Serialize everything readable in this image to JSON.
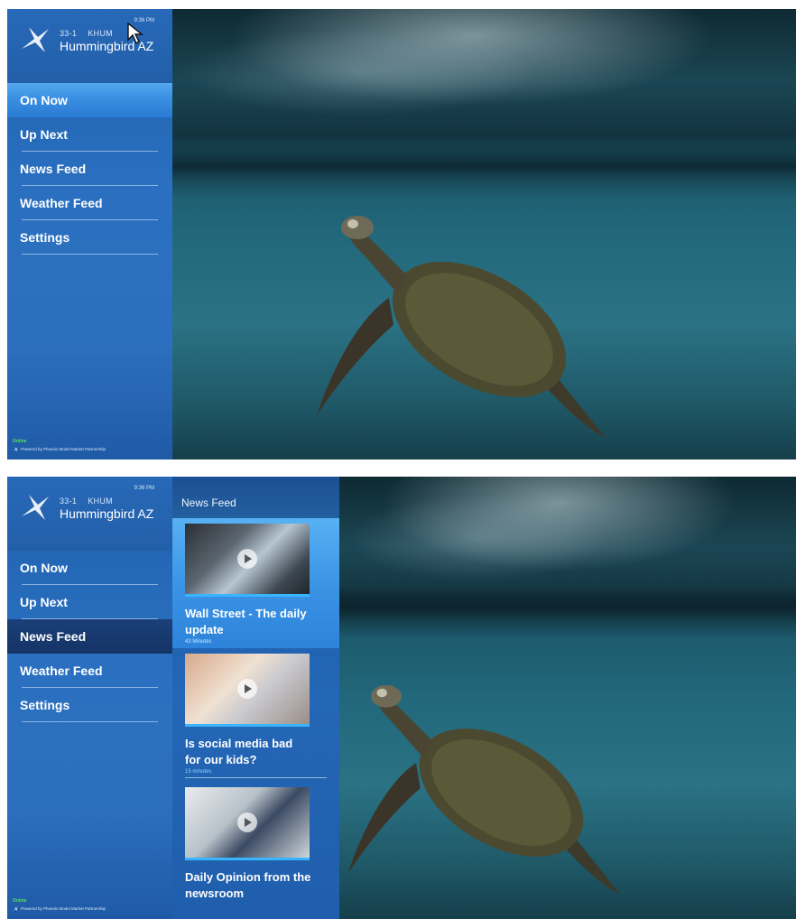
{
  "brand": {
    "channel_number": "33-1",
    "callsign": "KHUM",
    "station_name": "Hummingbird AZ",
    "time_top": "9:36 PM",
    "time_bottom": "9:36 PM"
  },
  "menu": [
    {
      "label": "On Now"
    },
    {
      "label": "Up Next"
    },
    {
      "label": "News Feed"
    },
    {
      "label": "Weather Feed"
    },
    {
      "label": "Settings"
    }
  ],
  "footer": {
    "status": "Online",
    "powered_by": "Powered by Phoenix Model Market Partnership"
  },
  "news_feed": {
    "header": "News Feed",
    "items": [
      {
        "title": "Wall Street - The daily update",
        "duration": "43 Minutes"
      },
      {
        "title": "Is social media bad for our kids?",
        "duration": "15 minutes"
      },
      {
        "title": "Daily Opinion from the newsroom",
        "duration": ""
      }
    ]
  },
  "colors": {
    "sidebar": "#2b70c0",
    "active_item": "#3a8fe2",
    "active_item_dark": "#153466",
    "online": "#55e45a",
    "thumb_bar": "#39b5ff"
  },
  "icons": [
    "hummingbird-logo-icon",
    "mouse-cursor-icon",
    "play-icon"
  ]
}
